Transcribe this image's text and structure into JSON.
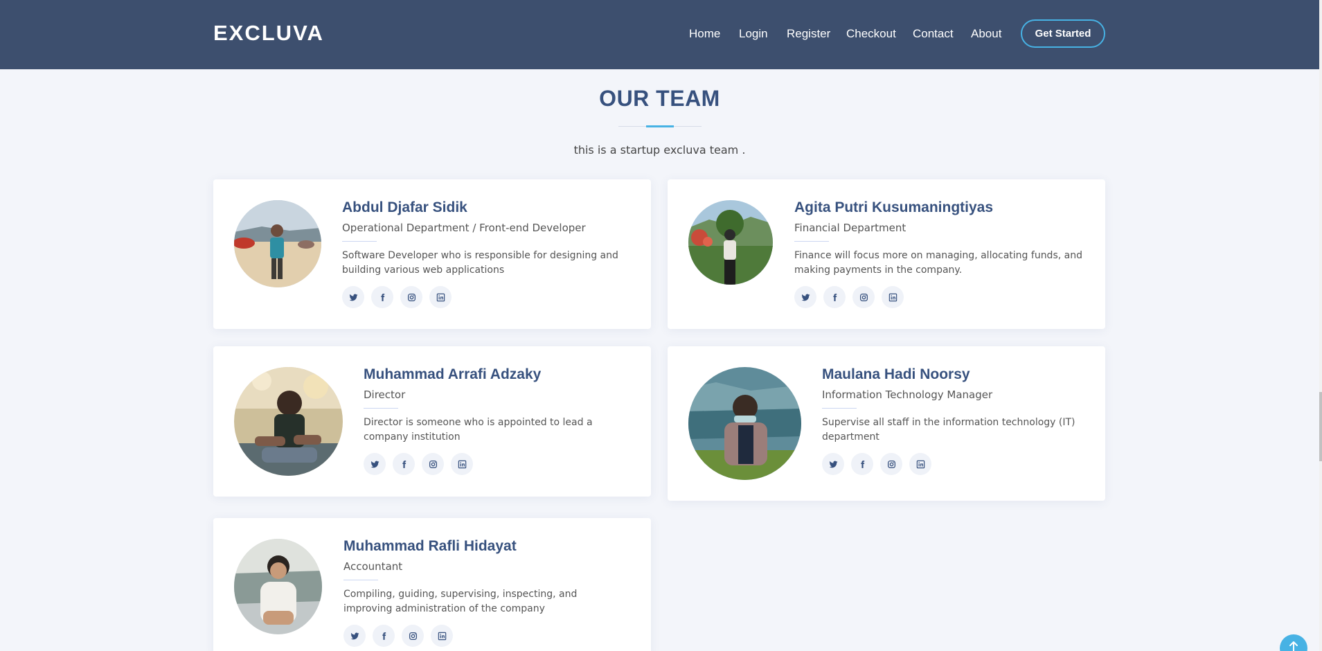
{
  "brand": {
    "logo": "EXCLUVA"
  },
  "nav": {
    "items": [
      {
        "label": "Home"
      },
      {
        "label": "Login"
      },
      {
        "label": "Register"
      },
      {
        "label": "Checkout"
      },
      {
        "label": "Contact"
      },
      {
        "label": "About"
      }
    ],
    "cta_label": "Get Started"
  },
  "team": {
    "title": "OUR TEAM",
    "subtitle": "this is a startup excluva team .",
    "members": [
      {
        "name": "Abdul Djafar Sidik",
        "role": "Operational Department / Front-end Developer",
        "description": "Software Developer who is responsible for designing and building various web applications"
      },
      {
        "name": "Agita Putri Kusumaningtiyas",
        "role": "Financial Department",
        "description": "Finance will focus more on managing, allocating funds, and making payments in the company."
      },
      {
        "name": "Muhammad Arrafi Adzaky",
        "role": "Director",
        "description": "Director is someone who is appointed to lead a company institution"
      },
      {
        "name": "Maulana Hadi Noorsy",
        "role": "Information Technology Manager",
        "description": "Supervise all staff in the information technology (IT) department"
      },
      {
        "name": "Muhammad Rafli Hidayat",
        "role": "Accountant",
        "description": "Compiling, guiding, supervising, inspecting, and improving administration of the company"
      }
    ],
    "social_icons": [
      "twitter-icon",
      "facebook-icon",
      "instagram-icon",
      "linkedin-icon"
    ]
  },
  "colors": {
    "header_bg": "#3d4f6e",
    "accent": "#47b2e4",
    "heading": "#37517e",
    "page_bg": "#f3f5fa"
  }
}
